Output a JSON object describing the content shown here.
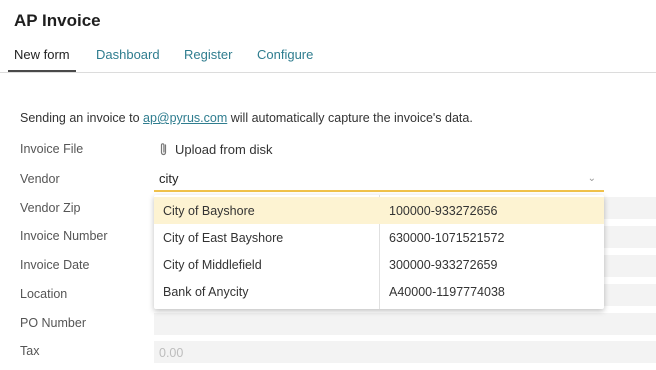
{
  "app": {
    "title": "AP Invoice"
  },
  "tabs": [
    {
      "label": "New form",
      "active": true
    },
    {
      "label": "Dashboard"
    },
    {
      "label": "Register"
    },
    {
      "label": "Configure"
    }
  ],
  "intro": {
    "before": "Sending an invoice to ",
    "email": "ap@pyrus.com",
    "after": " will automatically capture the invoice's data."
  },
  "form": {
    "invoice_file_label": "Invoice File",
    "upload_label": "Upload from disk",
    "upload_icon": "paperclip-icon",
    "vendor_label": "Vendor",
    "vendor_value": "city",
    "vendor_zip_label": "Vendor Zip",
    "invoice_number_label": "Invoice Number",
    "invoice_date_label": "Invoice Date",
    "location_label": "Location",
    "po_number_label": "PO Number",
    "tax_label": "Tax",
    "tax_placeholder": "0.00"
  },
  "vendor_dropdown": {
    "options": [
      {
        "name": "City of Bayshore",
        "code": "100000-933272656",
        "highlighted": true
      },
      {
        "name": "City of East Bayshore",
        "code": "630000-1071521572"
      },
      {
        "name": "City of Middlefield",
        "code": "300000-933272659"
      },
      {
        "name": "Bank of Anycity",
        "code": "A40000-1197774038"
      }
    ]
  },
  "colors": {
    "accent": "#2f7d8f",
    "focus_underline": "#f0c14b",
    "highlight": "#fdf3d2"
  }
}
